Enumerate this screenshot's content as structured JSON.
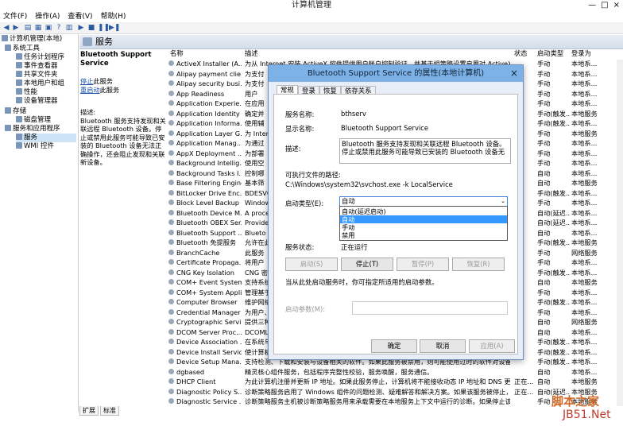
{
  "window": {
    "title": "计算机管理",
    "min": "—",
    "max": "□",
    "close": "×"
  },
  "menu": [
    "文件(F)",
    "操作(A)",
    "查看(V)",
    "帮助(H)"
  ],
  "tree": [
    {
      "label": "计算机管理(本地)",
      "depth": 0
    },
    {
      "label": "系统工具",
      "depth": 1
    },
    {
      "label": "任务计划程序",
      "depth": 2
    },
    {
      "label": "事件查看器",
      "depth": 2
    },
    {
      "label": "共享文件夹",
      "depth": 2
    },
    {
      "label": "本地用户和组",
      "depth": 2
    },
    {
      "label": "性能",
      "depth": 2
    },
    {
      "label": "设备管理器",
      "depth": 2
    },
    {
      "label": "存储",
      "depth": 1
    },
    {
      "label": "磁盘管理",
      "depth": 2
    },
    {
      "label": "服务和应用程序",
      "depth": 1
    },
    {
      "label": "服务",
      "depth": 2
    },
    {
      "label": "WMI 控件",
      "depth": 2
    }
  ],
  "pane_title": "服务",
  "desc": {
    "title": "Bluetooth Support Service",
    "stop_link": "停止",
    "stop_suffix": "此服务",
    "restart_link": "重启动",
    "restart_suffix": "此服务",
    "desc_label": "描述:",
    "desc_text": "Bluetooth 服务支持发现和关联远程 Bluetooth 设备。停止或禁用此服务可能导致已安装的 Bluetooth 设备无法正确操作，还会阻止发现和关联新设备。"
  },
  "columns": {
    "name": "名称",
    "desc": "描述",
    "status": "状态",
    "startup": "启动类型",
    "logon": "登录为"
  },
  "services": [
    {
      "name": "ActiveX Installer (A...",
      "desc": "为从 Internet 安装 ActiveX 控件提供用户帐户控制验证，并基于组策略设置启用对 ActiveX...",
      "status": "",
      "startup": "手动",
      "logon": "本地系..."
    },
    {
      "name": "Alipay payment clie...",
      "desc": "为支付",
      "status": "",
      "startup": "手动",
      "logon": "本地系..."
    },
    {
      "name": "Alipay security busi...",
      "desc": "为支付",
      "status": "",
      "startup": "手动",
      "logon": "本地系..."
    },
    {
      "name": "App Readiness",
      "desc": "用户",
      "status": "",
      "startup": "手动",
      "logon": "本地系..."
    },
    {
      "name": "Application Experie...",
      "desc": "在应用",
      "status": "",
      "startup": "手动",
      "logon": "本地系..."
    },
    {
      "name": "Application Identity",
      "desc": "确定并",
      "status": "",
      "startup": "手动(触发...",
      "logon": "本地服务"
    },
    {
      "name": "Application Informa...",
      "desc": "使用辅",
      "status": "",
      "startup": "手动(触发...",
      "logon": "本地系..."
    },
    {
      "name": "Application Layer G...",
      "desc": "为 Inter",
      "status": "",
      "startup": "手动",
      "logon": "本地服务"
    },
    {
      "name": "Application Manag...",
      "desc": "为通过",
      "status": "",
      "startup": "手动",
      "logon": "本地系..."
    },
    {
      "name": "AppX Deployment ...",
      "desc": "为部署",
      "status": "",
      "startup": "手动",
      "logon": "本地系..."
    },
    {
      "name": "Background Intellig...",
      "desc": "使用空",
      "status": "",
      "startup": "手动",
      "logon": "本地系..."
    },
    {
      "name": "Background Tasks I...",
      "desc": "控制哪",
      "status": "",
      "startup": "自动",
      "logon": "本地系..."
    },
    {
      "name": "Base Filtering Engine",
      "desc": "基本筛",
      "status": "",
      "startup": "自动",
      "logon": "本地服务"
    },
    {
      "name": "BitLocker Drive Enc...",
      "desc": "BDESVC",
      "status": "",
      "startup": "手动(触发...",
      "logon": "本地系..."
    },
    {
      "name": "Block Level Backup ...",
      "desc": "Window",
      "status": "",
      "startup": "手动",
      "logon": "本地系..."
    },
    {
      "name": "Bluetooth Device M...",
      "desc": "A proce",
      "status": "",
      "startup": "自动(延迟...",
      "logon": "本地系..."
    },
    {
      "name": "Bluetooth OBEX Ser...",
      "desc": "Provide",
      "status": "",
      "startup": "自动(延迟...",
      "logon": "本地系..."
    },
    {
      "name": "Bluetooth Support ...",
      "desc": "Blueto",
      "status": "",
      "startup": "自动",
      "logon": "本地系..."
    },
    {
      "name": "Bluetooth 免提服务",
      "desc": "允许在此",
      "status": "",
      "startup": "手动(触发...",
      "logon": "本地服务"
    },
    {
      "name": "BranchCache",
      "desc": "此服务",
      "status": "",
      "startup": "手动",
      "logon": "网络服务"
    },
    {
      "name": "Certificate Propaga...",
      "desc": "将用户",
      "status": "",
      "startup": "手动",
      "logon": "本地系..."
    },
    {
      "name": "CNG Key Isolation",
      "desc": "CNG 密",
      "status": "",
      "startup": "手动(触发...",
      "logon": "本地系..."
    },
    {
      "name": "COM+ Event System",
      "desc": "支持系统",
      "status": "",
      "startup": "自动",
      "logon": "本地服务"
    },
    {
      "name": "COM+ System Appli...",
      "desc": "管理基于",
      "status": "",
      "startup": "手动",
      "logon": "本地系..."
    },
    {
      "name": "Computer Browser",
      "desc": "维护网络",
      "status": "",
      "startup": "手动(触发...",
      "logon": "本地系..."
    },
    {
      "name": "Credential Manager",
      "desc": "为用户、",
      "status": "",
      "startup": "手动",
      "logon": "本地系..."
    },
    {
      "name": "Cryptographic Servi...",
      "desc": "提供三种",
      "status": "",
      "startup": "自动",
      "logon": "网络服务"
    },
    {
      "name": "DCOM Server Proc...",
      "desc": "DCOML",
      "status": "",
      "startup": "自动",
      "logon": "本地系..."
    },
    {
      "name": "Device Association ...",
      "desc": "在系统与",
      "status": "",
      "startup": "手动(触发...",
      "logon": "本地系..."
    },
    {
      "name": "Device Install Service",
      "desc": "使计算机",
      "status": "",
      "startup": "手动(触发...",
      "logon": "本地系..."
    },
    {
      "name": "Device Setup Mana...",
      "desc": "支持检测、下载和安装与设备相关的软件。如果此服务被禁用，则可能使用过时的软件对设备进...",
      "status": "",
      "startup": "手动(触发...",
      "logon": "本地系..."
    },
    {
      "name": "dgbased",
      "desc": "精灵核心组件服务，包括程序完整性校验，服务唤醒，服务通信。",
      "status": "",
      "startup": "自动",
      "logon": "本地系..."
    },
    {
      "name": "DHCP Client",
      "desc": "为此计算机注册并更新 IP 地址。如果此服务停止，计算机将不能接收动态 IP 地址和 DNS 更新...",
      "status": "正在...",
      "startup": "自动",
      "logon": "本地服务"
    },
    {
      "name": "Diagnostic Policy S...",
      "desc": "诊断策略服务启用了 Windows 组件的问题检测、疑难解答和解决方案。如果该服务被停止，诊...",
      "status": "正在...",
      "startup": "自动(延迟...",
      "logon": "本地服务"
    },
    {
      "name": "Diagnostic Service ...",
      "desc": "诊断策略服务主机被诊断策略服务用来承载需要在本地服务上下文中运行的诊断。如果停止该服务...",
      "status": "",
      "startup": "手动",
      "logon": "本地服务"
    }
  ],
  "bottom_tabs": [
    "扩展",
    "标准"
  ],
  "dialog": {
    "title": "Bluetooth Support Service 的属性(本地计算机)",
    "close": "×",
    "tabs": [
      "常规",
      "登录",
      "恢复",
      "依存关系"
    ],
    "service_name_label": "服务名称:",
    "service_name": "bthserv",
    "display_name_label": "显示名称:",
    "display_name": "Bluetooth Support Service",
    "desc_label": "描述:",
    "desc_line1": "Bluetooth 服务支持发现和关联远程 Bluetooth 设备。",
    "desc_line2": "停止或禁用此服务可能导致已安装的 Bluetooth 设备无",
    "path_label": "可执行文件的路径:",
    "path": "C:\\Windows\\system32\\svchost.exe -k LocalService",
    "startup_label": "启动类型(E):",
    "startup_value": "自动",
    "startup_options": [
      "自动(延迟启动)",
      "自动",
      "手动",
      "禁用"
    ],
    "startup_selected_index": 1,
    "status_label": "服务状态:",
    "status_value": "正在运行",
    "btn_start": "启动(S)",
    "btn_stop": "停止(T)",
    "btn_pause": "暂停(P)",
    "btn_resume": "恢复(R)",
    "hint": "当从此处启动服务时，你可指定所适用的启动参数。",
    "params_label": "启动参数(M):",
    "params_value": "",
    "ok": "确定",
    "cancel": "取消",
    "apply": "应用(A)"
  },
  "watermark": {
    "line1": "脚本之家",
    "line2": "JB51.Net"
  }
}
